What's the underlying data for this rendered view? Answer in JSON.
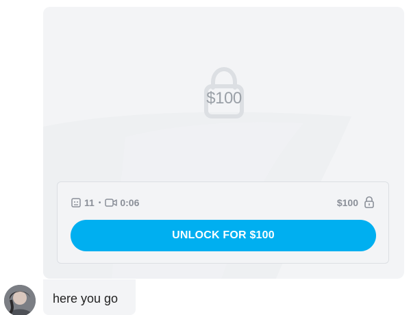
{
  "locked_post": {
    "overlay_price": "$100",
    "media": {
      "image_count": "11",
      "separator": "•",
      "video_duration": "0:06"
    },
    "price_label": "$100",
    "unlock_button_label": "UNLOCK FOR $100",
    "icons": {
      "image": "image-icon",
      "video": "video-camera-icon",
      "lock": "lock-icon",
      "overlay_lock": "padlock-icon"
    },
    "colors": {
      "button": "#00aff0",
      "card_background": "#f3f4f6",
      "muted_text": "#8a8f98"
    }
  },
  "message": {
    "text": "here you go",
    "avatar": "avatar"
  }
}
